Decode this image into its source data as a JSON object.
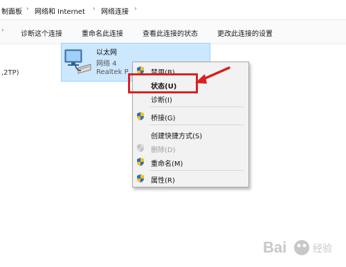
{
  "breadcrumb": {
    "items": [
      "制面板",
      "网络和 Internet",
      "网络连接"
    ]
  },
  "toolbar": {
    "items": [
      "诊断这个连接",
      "重命名此连接",
      "查看此连接的状态",
      "更改此连接的设置"
    ]
  },
  "left_partial_label": ",2TP)",
  "adapter": {
    "name": "以太网",
    "network": "网络  4",
    "device": "Realtek P"
  },
  "context_menu": {
    "items": [
      {
        "label": "禁用(B)",
        "icon": "shield-icon",
        "enabled": true
      },
      {
        "label": "状态(U)",
        "icon": "",
        "enabled": true,
        "bold": true
      },
      {
        "label": "诊断(I)",
        "icon": "",
        "enabled": true
      },
      {
        "label": "桥接(G)",
        "icon": "shield-icon",
        "enabled": true
      },
      {
        "label": "创建快捷方式(S)",
        "icon": "",
        "enabled": true
      },
      {
        "label": "删除(D)",
        "icon": "shield-icon",
        "enabled": false
      },
      {
        "label": "重命名(M)",
        "icon": "shield-icon",
        "enabled": true
      },
      {
        "label": "属性(R)",
        "icon": "shield-icon",
        "enabled": true
      }
    ]
  },
  "annotation": {
    "color": "#d91f1f"
  },
  "watermark": {
    "text": "Bai",
    "sub": "经验"
  }
}
